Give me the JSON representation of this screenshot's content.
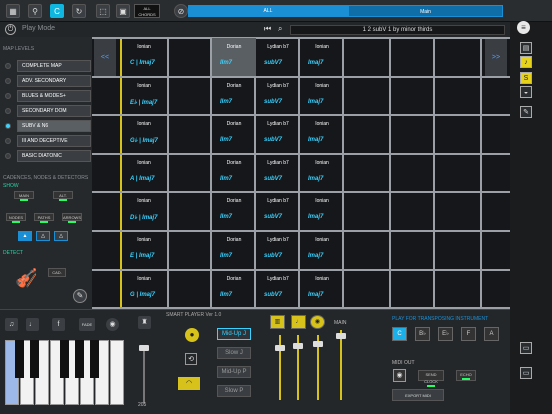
{
  "toolbar": {
    "all_chords_label": "ALL CHORDS",
    "segment_all": "ALL",
    "segment_main": "Main"
  },
  "playbar": {
    "mode_label": "Play Mode"
  },
  "song": {
    "title": "1 2 subV 1 by minor thirds"
  },
  "left": {
    "map_levels_header": "MAP LEVELS",
    "levels": [
      "COMPLETE MAP",
      "ADV. SECONDARY",
      "BLUES & MODES+",
      "SECONDARY DOM",
      "SUBV & N6",
      "III AND DECEPTIVE",
      "BASIC DIATONIC"
    ],
    "active_level": 4,
    "cadences_header": "CADENCES, NODES & DETECTORS",
    "show_label": "SHOW",
    "main_label": "MAIN",
    "alt_label": "ALT.",
    "nodes_label": "NODES",
    "paths_label": "PATHS",
    "arrows_label": "ARROWS",
    "tri_options": [
      "▲",
      "△",
      "△"
    ],
    "detect_label": "DETECT",
    "cad_label": "CAD."
  },
  "grid": {
    "nav_left": "<<",
    "nav_right": ">>",
    "modes": [
      "Ionian",
      "Dorian",
      "Lydian b7",
      "Ionian"
    ],
    "rows": [
      [
        "C | Imaj7",
        "IIm7",
        "subV7",
        "Imaj7"
      ],
      [
        "E♭ | Imaj7",
        "IIm7",
        "subV7",
        "Imaj7"
      ],
      [
        "G♭ | Imaj7",
        "IIm7",
        "subV7",
        "Imaj7"
      ],
      [
        "A | Imaj7",
        "IIm7",
        "subV7",
        "Imaj7"
      ],
      [
        "D♭ | Imaj7",
        "IIm7",
        "subV7",
        "Imaj7"
      ],
      [
        "E | Imaj7",
        "IIm7",
        "subV7",
        "Imaj7"
      ],
      [
        "G | Imaj7",
        "IIm7",
        "subV7",
        "Imaj7"
      ]
    ]
  },
  "bottom": {
    "smart_player_label": "SMART PLAYER Ver 1.0",
    "speeds": [
      "Mid-Up J",
      "Slow J",
      "Mid-Up P",
      "Slow P"
    ],
    "active_speed": 0,
    "tempo": "205",
    "main_label": "MAIN",
    "transpose_label": "PLAY FOR TRANSPOSING INSTRUMENT",
    "transpose_keys": [
      "C",
      "B♭",
      "E♭",
      "F",
      "A"
    ],
    "midi_out_label": "MIDI OUT",
    "send_clock_label": "SEND CLOCK",
    "echo_label": "ECHO",
    "export_label": "EXPORT MIDI",
    "fade_label": "FADE"
  },
  "colors": {
    "accent": "#1a8fd6",
    "chord": "#3ad2ff",
    "highlight": "#d6c21a"
  }
}
